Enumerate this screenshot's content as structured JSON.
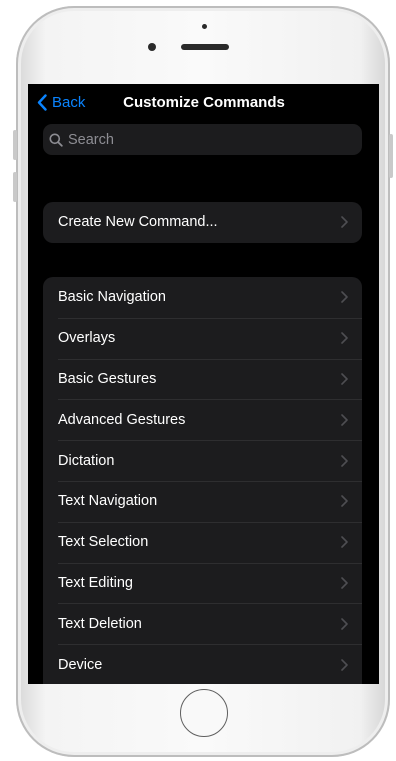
{
  "navbar": {
    "back_label": "Back",
    "title": "Customize Commands"
  },
  "search": {
    "placeholder": "Search"
  },
  "create_group": {
    "items": [
      {
        "label": "Create New Command..."
      }
    ]
  },
  "commands_group": {
    "items": [
      {
        "label": "Basic Navigation"
      },
      {
        "label": "Overlays"
      },
      {
        "label": "Basic Gestures"
      },
      {
        "label": "Advanced Gestures"
      },
      {
        "label": "Dictation"
      },
      {
        "label": "Text Navigation"
      },
      {
        "label": "Text Selection"
      },
      {
        "label": "Text Editing"
      },
      {
        "label": "Text Deletion"
      },
      {
        "label": "Device"
      }
    ]
  },
  "colors": {
    "accent": "#0a84ff",
    "screen_background": "#000000",
    "cell_background": "#1c1c1e",
    "device_frame": "#f4f4f4"
  },
  "icons": [
    "chevron-left-icon",
    "search-icon",
    "chevron-right-icon"
  ]
}
